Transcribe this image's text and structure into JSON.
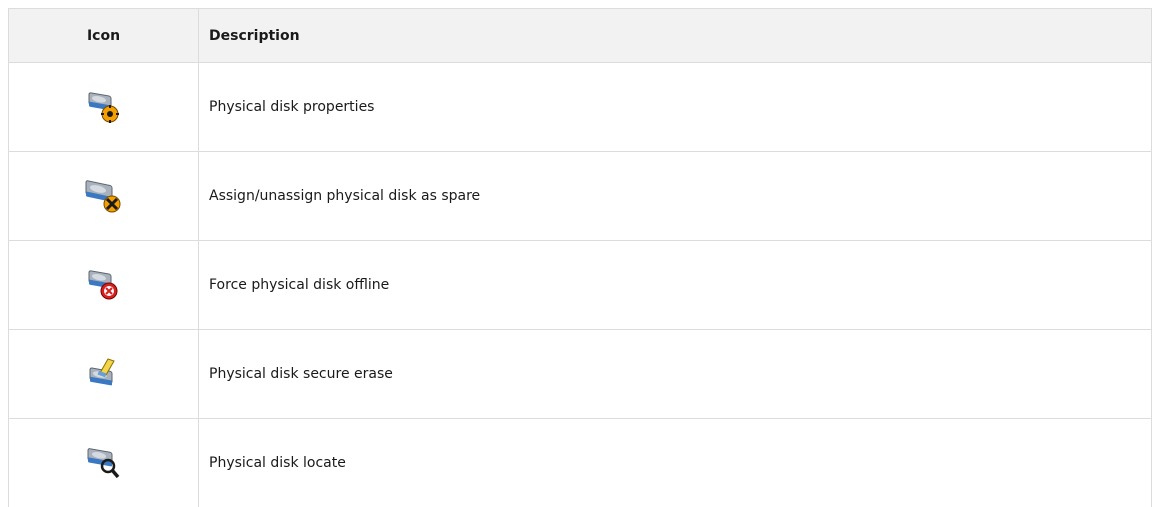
{
  "table": {
    "headers": {
      "icon": "Icon",
      "description": "Description"
    },
    "rows": [
      {
        "icon": "disk-properties-icon",
        "description": "Physical disk properties"
      },
      {
        "icon": "disk-spare-icon",
        "description": "Assign/unassign physical disk as spare"
      },
      {
        "icon": "disk-offline-icon",
        "description": "Force physical disk offline"
      },
      {
        "icon": "disk-erase-icon",
        "description": "Physical disk secure erase"
      },
      {
        "icon": "disk-locate-icon",
        "description": "Physical disk locate"
      }
    ]
  },
  "colors": {
    "header_bg": "#f2f2f2",
    "border": "#dcdcdc",
    "disk_blue": "#3a78c2",
    "disk_gray": "#a9b2bc",
    "badge_orange": "#f4a000",
    "badge_red": "#d62020"
  }
}
